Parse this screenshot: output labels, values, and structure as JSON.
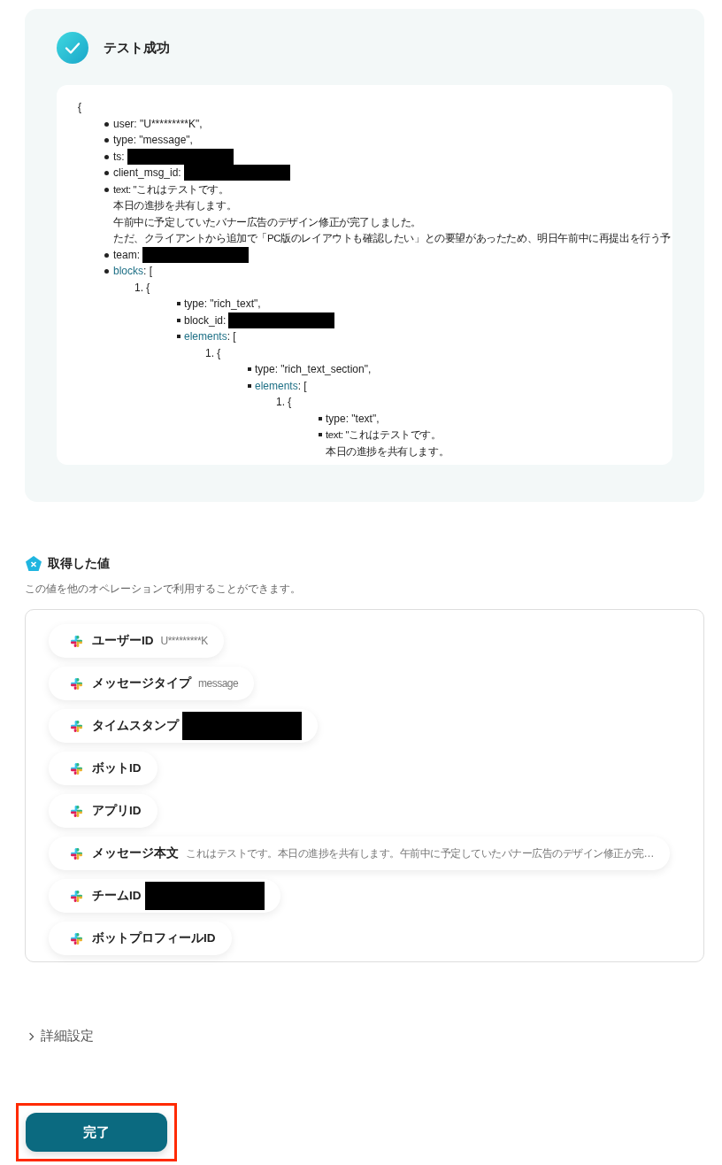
{
  "result": {
    "title": "テスト成功",
    "json_view": {
      "open": "{",
      "items": [
        {
          "kind": "field",
          "text": "user: \"U*********K\","
        },
        {
          "kind": "field",
          "text": "type: \"message\","
        },
        {
          "kind": "field",
          "text": "ts:",
          "redacted": true
        },
        {
          "kind": "field",
          "text": "client_msg_id:",
          "redacted": true
        },
        {
          "kind": "field",
          "lines": [
            "text: \"これはテストです。",
            "本日の進捗を共有します。",
            "午前中に予定していたバナー広告のデザイン修正が完了しました。",
            "ただ、クライアントから追加で「PC版のレイアウトも確認したい」との要望があったため、明日午前中に再提出を行う予"
          ]
        },
        {
          "kind": "field",
          "text": "team:",
          "redacted": true
        },
        {
          "kind": "group",
          "key": "blocks",
          "open": ": [",
          "children": [
            {
              "kind": "index",
              "label": "1. {",
              "children": [
                {
                  "kind": "field",
                  "text": "type: \"rich_text\","
                },
                {
                  "kind": "field",
                  "text": "block_id:",
                  "redacted": true
                },
                {
                  "kind": "group",
                  "key": "elements",
                  "open": ": [",
                  "children": [
                    {
                      "kind": "index",
                      "label": "1. {",
                      "children": [
                        {
                          "kind": "field",
                          "text": "type: \"rich_text_section\","
                        },
                        {
                          "kind": "group",
                          "key": "elements",
                          "open": ": [",
                          "children": [
                            {
                              "kind": "index",
                              "label": "1. {",
                              "children": [
                                {
                                  "kind": "field",
                                  "text": "type: \"text\","
                                },
                                {
                                  "kind": "field",
                                  "lines": [
                                    "text: \"これはテストです。",
                                    "本日の進捗を共有します。"
                                  ]
                                }
                              ]
                            }
                          ]
                        }
                      ]
                    }
                  ]
                }
              ]
            }
          ]
        }
      ]
    }
  },
  "values": {
    "title": "取得した値",
    "description": "この値を他のオペレーションで利用することができます。",
    "items": [
      {
        "label": "ユーザーID",
        "value": "U*********K"
      },
      {
        "label": "メッセージタイプ",
        "value": "message"
      },
      {
        "label": "タイムスタンプ",
        "redacted": true
      },
      {
        "label": "ボットID"
      },
      {
        "label": "アプリID"
      },
      {
        "label": "メッセージ本文",
        "value": "これはテストです。本日の進捗を共有します。午前中に予定していたバナー広告のデザイン修正が完…"
      },
      {
        "label": "チームID",
        "redacted": true
      },
      {
        "label": "ボットプロフィールID"
      }
    ]
  },
  "advanced": {
    "label": "詳細設定",
    "expanded": false
  },
  "done_button": {
    "label": "完了",
    "highlighted": true
  }
}
